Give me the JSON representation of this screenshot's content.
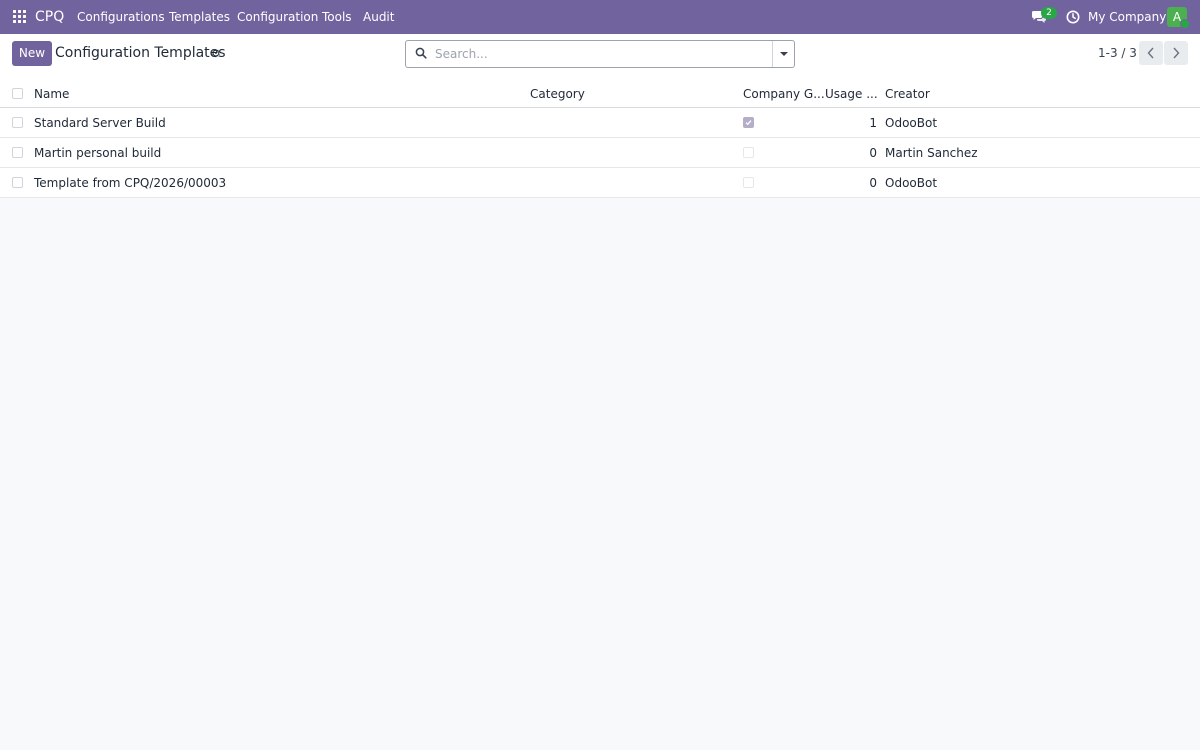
{
  "navbar": {
    "brand": "CPQ",
    "menu": [
      "Configurations",
      "Templates",
      "Configuration",
      "Tools",
      "Audit"
    ],
    "chat_count": "2",
    "company": "My Company",
    "avatar_letter": "A"
  },
  "control_panel": {
    "new_label": "New",
    "title": "Configuration Templates",
    "search_placeholder": "Search...",
    "pager": "1-3 / 3"
  },
  "list": {
    "columns": [
      "Name",
      "Category",
      "Company G...",
      "Usage ...",
      "Creator"
    ],
    "rows": [
      {
        "name": "Standard Server Build",
        "category": "",
        "company_global": true,
        "usage": "1",
        "creator": "OdooBot"
      },
      {
        "name": "Martin personal build",
        "category": "",
        "company_global": false,
        "usage": "0",
        "creator": "Martin Sanchez"
      },
      {
        "name": "Template from CPQ/2026/00003",
        "category": "",
        "company_global": false,
        "usage": "0",
        "creator": "OdooBot"
      }
    ]
  },
  "colors": {
    "brand": "#71639e",
    "background": "#f8f9fb",
    "badge": "#28a745"
  },
  "icons": [
    "apps-grid-icon",
    "chat-icon",
    "clock-icon",
    "gear-icon",
    "search-icon",
    "caret-down-icon",
    "chevron-left-icon",
    "chevron-right-icon",
    "check-icon"
  ]
}
